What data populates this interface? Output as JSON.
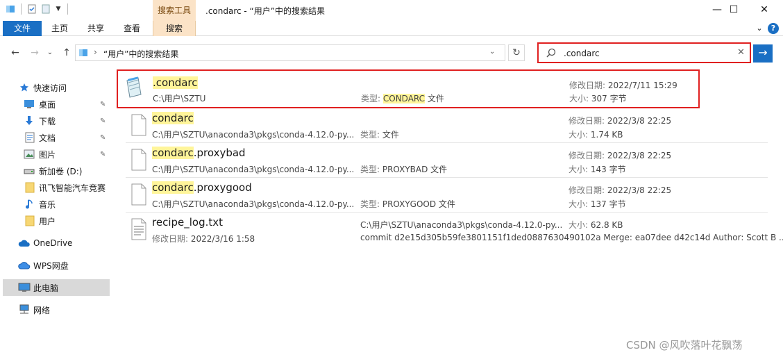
{
  "window": {
    "title": ".condarc - “用户”中的搜索结果",
    "tool_tab": "搜索工具",
    "controls": {
      "minimize": "—",
      "maximize": "☐",
      "close": "✕"
    }
  },
  "ribbon": {
    "tabs": [
      "文件",
      "主页",
      "共享",
      "查看",
      "搜索"
    ],
    "collapse": "⌄",
    "help": "?"
  },
  "nav": {
    "back": "←",
    "forward": "→",
    "recent": "⌄",
    "up": "↑",
    "path": "“用户”中的搜索结果",
    "refresh": "↻"
  },
  "search": {
    "value": ".condarc",
    "clear": "✕",
    "go": "→"
  },
  "sidebar": {
    "items": [
      {
        "label": "快速访问",
        "icon": "star-icon"
      },
      {
        "label": "桌面",
        "icon": "desktop-icon",
        "pin": "📌"
      },
      {
        "label": "下载",
        "icon": "download-icon",
        "pin": "📌"
      },
      {
        "label": "文档",
        "icon": "documents-icon",
        "pin": "📌"
      },
      {
        "label": "图片",
        "icon": "pictures-icon",
        "pin": "📌"
      },
      {
        "label": "新加卷 (D:)",
        "icon": "drive-icon"
      },
      {
        "label": "讯飞智能汽车竞赛",
        "icon": "folder-icon"
      },
      {
        "label": "音乐",
        "icon": "music-icon"
      },
      {
        "label": "用户",
        "icon": "folder-icon"
      },
      {
        "label": "OneDrive",
        "icon": "cloud-icon"
      },
      {
        "label": "WPS网盘",
        "icon": "wps-cloud-icon"
      },
      {
        "label": "此电脑",
        "icon": "computer-icon"
      },
      {
        "label": "网络",
        "icon": "network-icon"
      }
    ]
  },
  "files": [
    {
      "match": ".condarc",
      "rest": "",
      "path": "C:\\用户\\SZTU",
      "type_label": "类型:",
      "type_match": "CONDARC",
      "type_rest": " 文件",
      "date_label": "修改日期:",
      "date": "2022/7/11 15:29",
      "size_label": "大小:",
      "size": "307 字节"
    },
    {
      "match": "condarc",
      "rest": "",
      "path": "C:\\用户\\SZTU\\anaconda3\\pkgs\\conda-4.12.0-py...",
      "type_label": "类型:",
      "type_match": "",
      "type_rest": " 文件",
      "date_label": "修改日期:",
      "date": "2022/3/8 22:25",
      "size_label": "大小:",
      "size": "1.74 KB"
    },
    {
      "match": "condarc",
      "rest": ".proxybad",
      "path": "C:\\用户\\SZTU\\anaconda3\\pkgs\\conda-4.12.0-py...",
      "type_label": "类型:",
      "type_match": "",
      "type_rest": " PROXYBAD 文件",
      "date_label": "修改日期:",
      "date": "2022/3/8 22:25",
      "size_label": "大小:",
      "size": "143 字节"
    },
    {
      "match": "condarc",
      "rest": ".proxygood",
      "path": "C:\\用户\\SZTU\\anaconda3\\pkgs\\conda-4.12.0-py...",
      "type_label": "类型:",
      "type_match": "",
      "type_rest": " PROXYGOOD 文件",
      "date_label": "修改日期:",
      "date": "2022/3/8 22:25",
      "size_label": "大小:",
      "size": "137 字节"
    }
  ],
  "file5": {
    "name": "recipe_log.txt",
    "date_label": "修改日期:",
    "date": "2022/3/16 1:58",
    "path": "C:\\用户\\SZTU\\anaconda3\\pkgs\\conda-4.12.0-py...",
    "commit": "commit d2e15d305b59fe3801151f1ded0887630490102a Merge: ea07dee d42c14d Author: Scott B ...",
    "size_label": "大小:",
    "size": "62.8 KB"
  },
  "watermark": "CSDN @风吹落叶花飘荡",
  "colors": {
    "accent": "#1a6fc4",
    "highlight": "#fff59a",
    "annotation": "#e02020",
    "tool_tab": "#fbe3c7"
  }
}
